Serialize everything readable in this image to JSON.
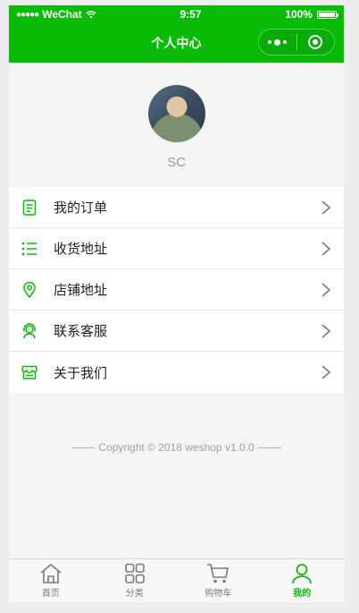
{
  "status_bar": {
    "carrier": "WeChat",
    "time": "9:57",
    "battery_text": "100%",
    "battery_level": 1.0
  },
  "nav": {
    "title": "个人中心",
    "menu_icon": "more-dots-icon",
    "close_icon": "target-circle-icon"
  },
  "profile": {
    "name": "SC"
  },
  "menu": [
    {
      "label": "我的订单",
      "icon": "document-icon"
    },
    {
      "label": "收货地址",
      "icon": "list-icon"
    },
    {
      "label": "店铺地址",
      "icon": "location-pin-icon"
    },
    {
      "label": "联系客服",
      "icon": "customer-service-icon"
    },
    {
      "label": "关于我们",
      "icon": "store-icon"
    }
  ],
  "footer": {
    "copyright": "Copyright © 2018 weshop v1.0.0"
  },
  "tabs": [
    {
      "label": "首页",
      "icon": "home-icon",
      "active": false
    },
    {
      "label": "分类",
      "icon": "category-grid-icon",
      "active": false
    },
    {
      "label": "购物车",
      "icon": "cart-icon",
      "active": false
    },
    {
      "label": "我的",
      "icon": "user-icon",
      "active": true
    }
  ],
  "colors": {
    "brand": "#09bb07",
    "tab_inactive": "#7a7a7a",
    "background": "#f4f4f4"
  }
}
